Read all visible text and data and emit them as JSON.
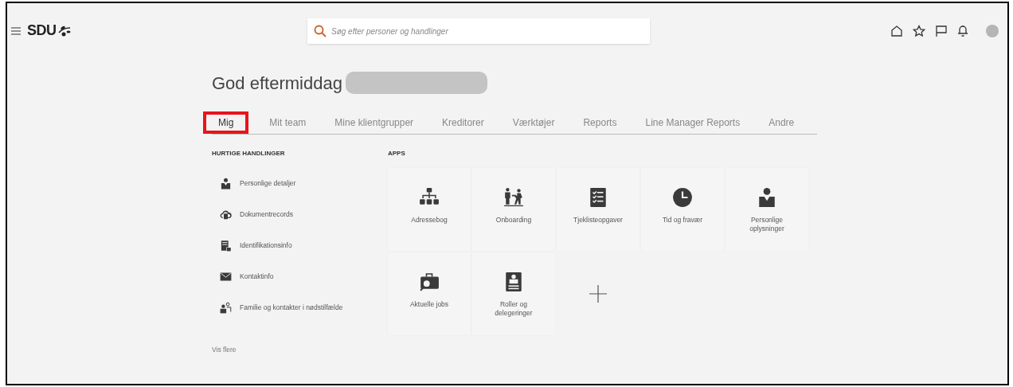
{
  "header": {
    "logo": "SDU",
    "search": {
      "placeholder": "Søg efter personer og handlinger"
    }
  },
  "greeting": {
    "text": "God eftermiddag",
    "name_redacted": true
  },
  "tabs": [
    {
      "label": "Mig",
      "selected": true,
      "highlighted": true
    },
    {
      "label": "Mit team",
      "selected": false,
      "highlighted": false
    },
    {
      "label": "Mine klientgrupper",
      "selected": false,
      "highlighted": false
    },
    {
      "label": "Kreditorer",
      "selected": false,
      "highlighted": false
    },
    {
      "label": "Værktøjer",
      "selected": false,
      "highlighted": false
    },
    {
      "label": "Reports",
      "selected": false,
      "highlighted": false
    },
    {
      "label": "Line Manager Reports",
      "selected": false,
      "highlighted": false
    },
    {
      "label": "Andre",
      "selected": false,
      "highlighted": false
    }
  ],
  "quick_actions": {
    "title": "HURTIGE HANDLINGER",
    "items": [
      {
        "label": "Personlige detaljer",
        "kind": "person"
      },
      {
        "label": "Dokumentrecords",
        "kind": "cloud"
      },
      {
        "label": "Identifikationsinfo",
        "kind": "idcard"
      },
      {
        "label": "Kontaktinfo",
        "kind": "mail"
      },
      {
        "label": "Familie og kontakter i nødstilfælde",
        "kind": "family"
      }
    ],
    "more": "Vis flere"
  },
  "apps": {
    "title": "APPS",
    "tiles": [
      {
        "label": "Adressebog",
        "kind": "org"
      },
      {
        "label": "Onboarding",
        "kind": "people"
      },
      {
        "label": "Tjeklisteopgaver",
        "kind": "checklist"
      },
      {
        "label": "Tid og fravær",
        "kind": "clock"
      },
      {
        "label": "Personlige oplysninger",
        "kind": "person"
      },
      {
        "label": "Aktuelle jobs",
        "kind": "briefcase"
      },
      {
        "label": "Roller og delegeringer",
        "kind": "badge"
      },
      {
        "kind": "add"
      }
    ]
  }
}
